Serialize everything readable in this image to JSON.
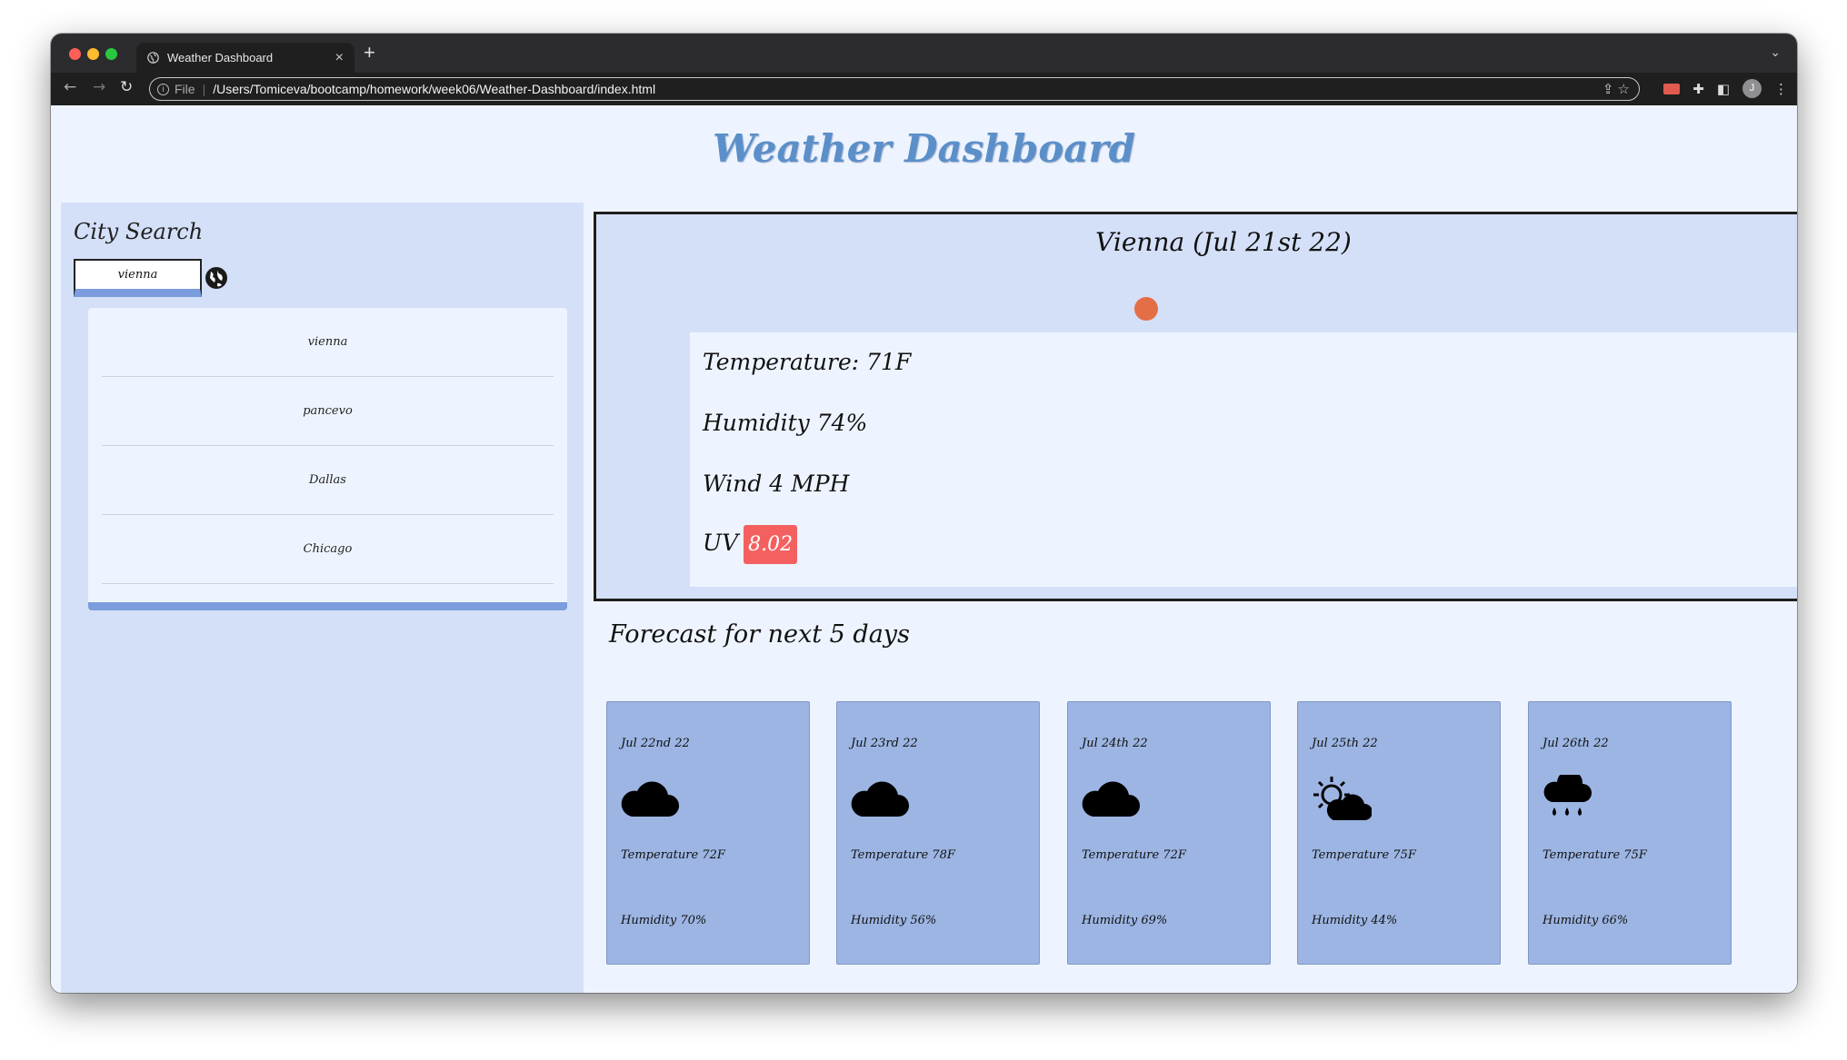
{
  "browser": {
    "tab_title": "Weather Dashboard",
    "new_tab": "+",
    "close": "×",
    "scheme": "File",
    "separator": "|",
    "url": "/Users/Tomiceva/bootcamp/homework/week06/Weather-Dashboard/index.html",
    "avatar_letter": "J"
  },
  "header": {
    "title": "Weather Dashboard"
  },
  "search": {
    "title": "City Search",
    "value": "vienna",
    "history": [
      "vienna",
      "pancevo",
      "Dallas",
      "Chicago"
    ]
  },
  "current": {
    "city_date": "Vienna (Jul 21st 22)",
    "temperature": "Temperature: 71F",
    "humidity": "Humidity 74%",
    "wind": "Wind 4 MPH",
    "uv_label": "UV",
    "uv_value": "8.02",
    "uv_color": "#f46060",
    "icon": "sun-icon",
    "icon_color": "#e46e46"
  },
  "forecast": {
    "title": "Forecast for next 5 days",
    "days": [
      {
        "date": "Jul 22nd 22",
        "icon": "cloud-icon",
        "temp": "Temperature 72F",
        "humidity": "Humidity 70%"
      },
      {
        "date": "Jul 23rd 22",
        "icon": "cloud-icon",
        "temp": "Temperature 78F",
        "humidity": "Humidity 56%"
      },
      {
        "date": "Jul 24th 22",
        "icon": "cloud-icon",
        "temp": "Temperature 72F",
        "humidity": "Humidity 69%"
      },
      {
        "date": "Jul 25th 22",
        "icon": "sun-cloud-icon",
        "temp": "Temperature 75F",
        "humidity": "Humidity 44%"
      },
      {
        "date": "Jul 26th 22",
        "icon": "rain-icon",
        "temp": "Temperature 75F",
        "humidity": "Humidity 66%"
      }
    ]
  },
  "colors": {
    "accent": "#5b8fc9",
    "panel": "#d4e0f8",
    "card": "#9cb5e3",
    "underline": "#7b9ddd"
  }
}
